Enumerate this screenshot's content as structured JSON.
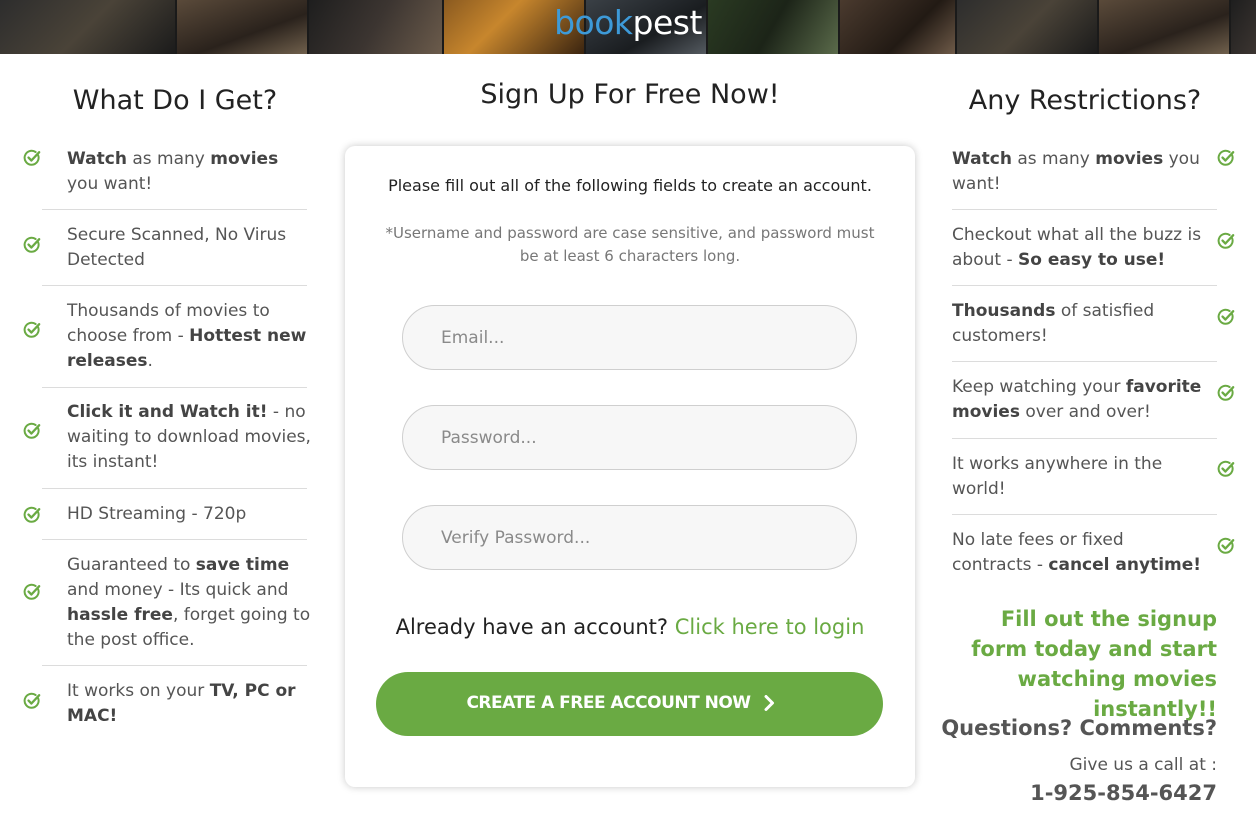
{
  "brand": {
    "logo_part1": "book",
    "logo_part2": "pest",
    "accent_color": "#3d9ad8",
    "green": "#6aaa43"
  },
  "left": {
    "title": "What Do I Get?",
    "items": [
      [
        {
          "t": "Watch",
          "b": true
        },
        {
          "t": " as many ",
          "b": false
        },
        {
          "t": "movies",
          "b": true
        },
        {
          "t": " you want!",
          "b": false
        }
      ],
      [
        {
          "t": "Secure Scanned, No Virus Detected",
          "b": false
        }
      ],
      [
        {
          "t": "Thousands of movies to choose from - ",
          "b": false
        },
        {
          "t": "Hottest new releases",
          "b": true
        },
        {
          "t": ".",
          "b": false
        }
      ],
      [
        {
          "t": "Click it and Watch it!",
          "b": true
        },
        {
          "t": " - no waiting to download movies, its instant!",
          "b": false
        }
      ],
      [
        {
          "t": "HD Streaming - 720p",
          "b": false
        }
      ],
      [
        {
          "t": "Guaranteed to ",
          "b": false
        },
        {
          "t": "save time",
          "b": true
        },
        {
          "t": " and money - Its quick and ",
          "b": false
        },
        {
          "t": "hassle free",
          "b": true
        },
        {
          "t": ", forget going to the post office.",
          "b": false
        }
      ],
      [
        {
          "t": "It works on your ",
          "b": false
        },
        {
          "t": "TV, PC or MAC!",
          "b": true
        }
      ]
    ]
  },
  "right": {
    "title": "Any Restrictions?",
    "items": [
      [
        {
          "t": "Watch",
          "b": true
        },
        {
          "t": " as many ",
          "b": false
        },
        {
          "t": "movies",
          "b": true
        },
        {
          "t": " you want!",
          "b": false
        }
      ],
      [
        {
          "t": "Checkout what all the buzz is about - ",
          "b": false
        },
        {
          "t": "So easy to use!",
          "b": true
        }
      ],
      [
        {
          "t": "Thousands",
          "b": true
        },
        {
          "t": " of satisfied customers!",
          "b": false
        }
      ],
      [
        {
          "t": "Keep watching your ",
          "b": false
        },
        {
          "t": "favorite movies",
          "b": true
        },
        {
          "t": " over and over!",
          "b": false
        }
      ],
      [
        {
          "t": "It works anywhere in the world!",
          "b": false
        }
      ],
      [
        {
          "t": "No late fees or fixed contracts - ",
          "b": false
        },
        {
          "t": "cancel anytime!",
          "b": true
        }
      ]
    ],
    "promo": "Fill out the signup form today and start watching movies instantly!!",
    "questions": "Questions? Comments?",
    "call_label": "Give us a call at :",
    "phone": "1-925-854-6427"
  },
  "signup": {
    "title": "Sign Up For Free Now!",
    "intro": "Please fill out all of the following fields to create an account.",
    "note": "*Username and password are case sensitive, and password must be at least 6 characters long.",
    "email_placeholder": "Email...",
    "password_placeholder": "Password...",
    "verify_placeholder": "Verify Password...",
    "login_prompt": "Already have an account? ",
    "login_link": "Click here to login",
    "cta_label": "CREATE A FREE ACCOUNT NOW",
    "cta_icon": "chevron-right-icon"
  },
  "icons": {
    "check": "check-circle-icon"
  }
}
